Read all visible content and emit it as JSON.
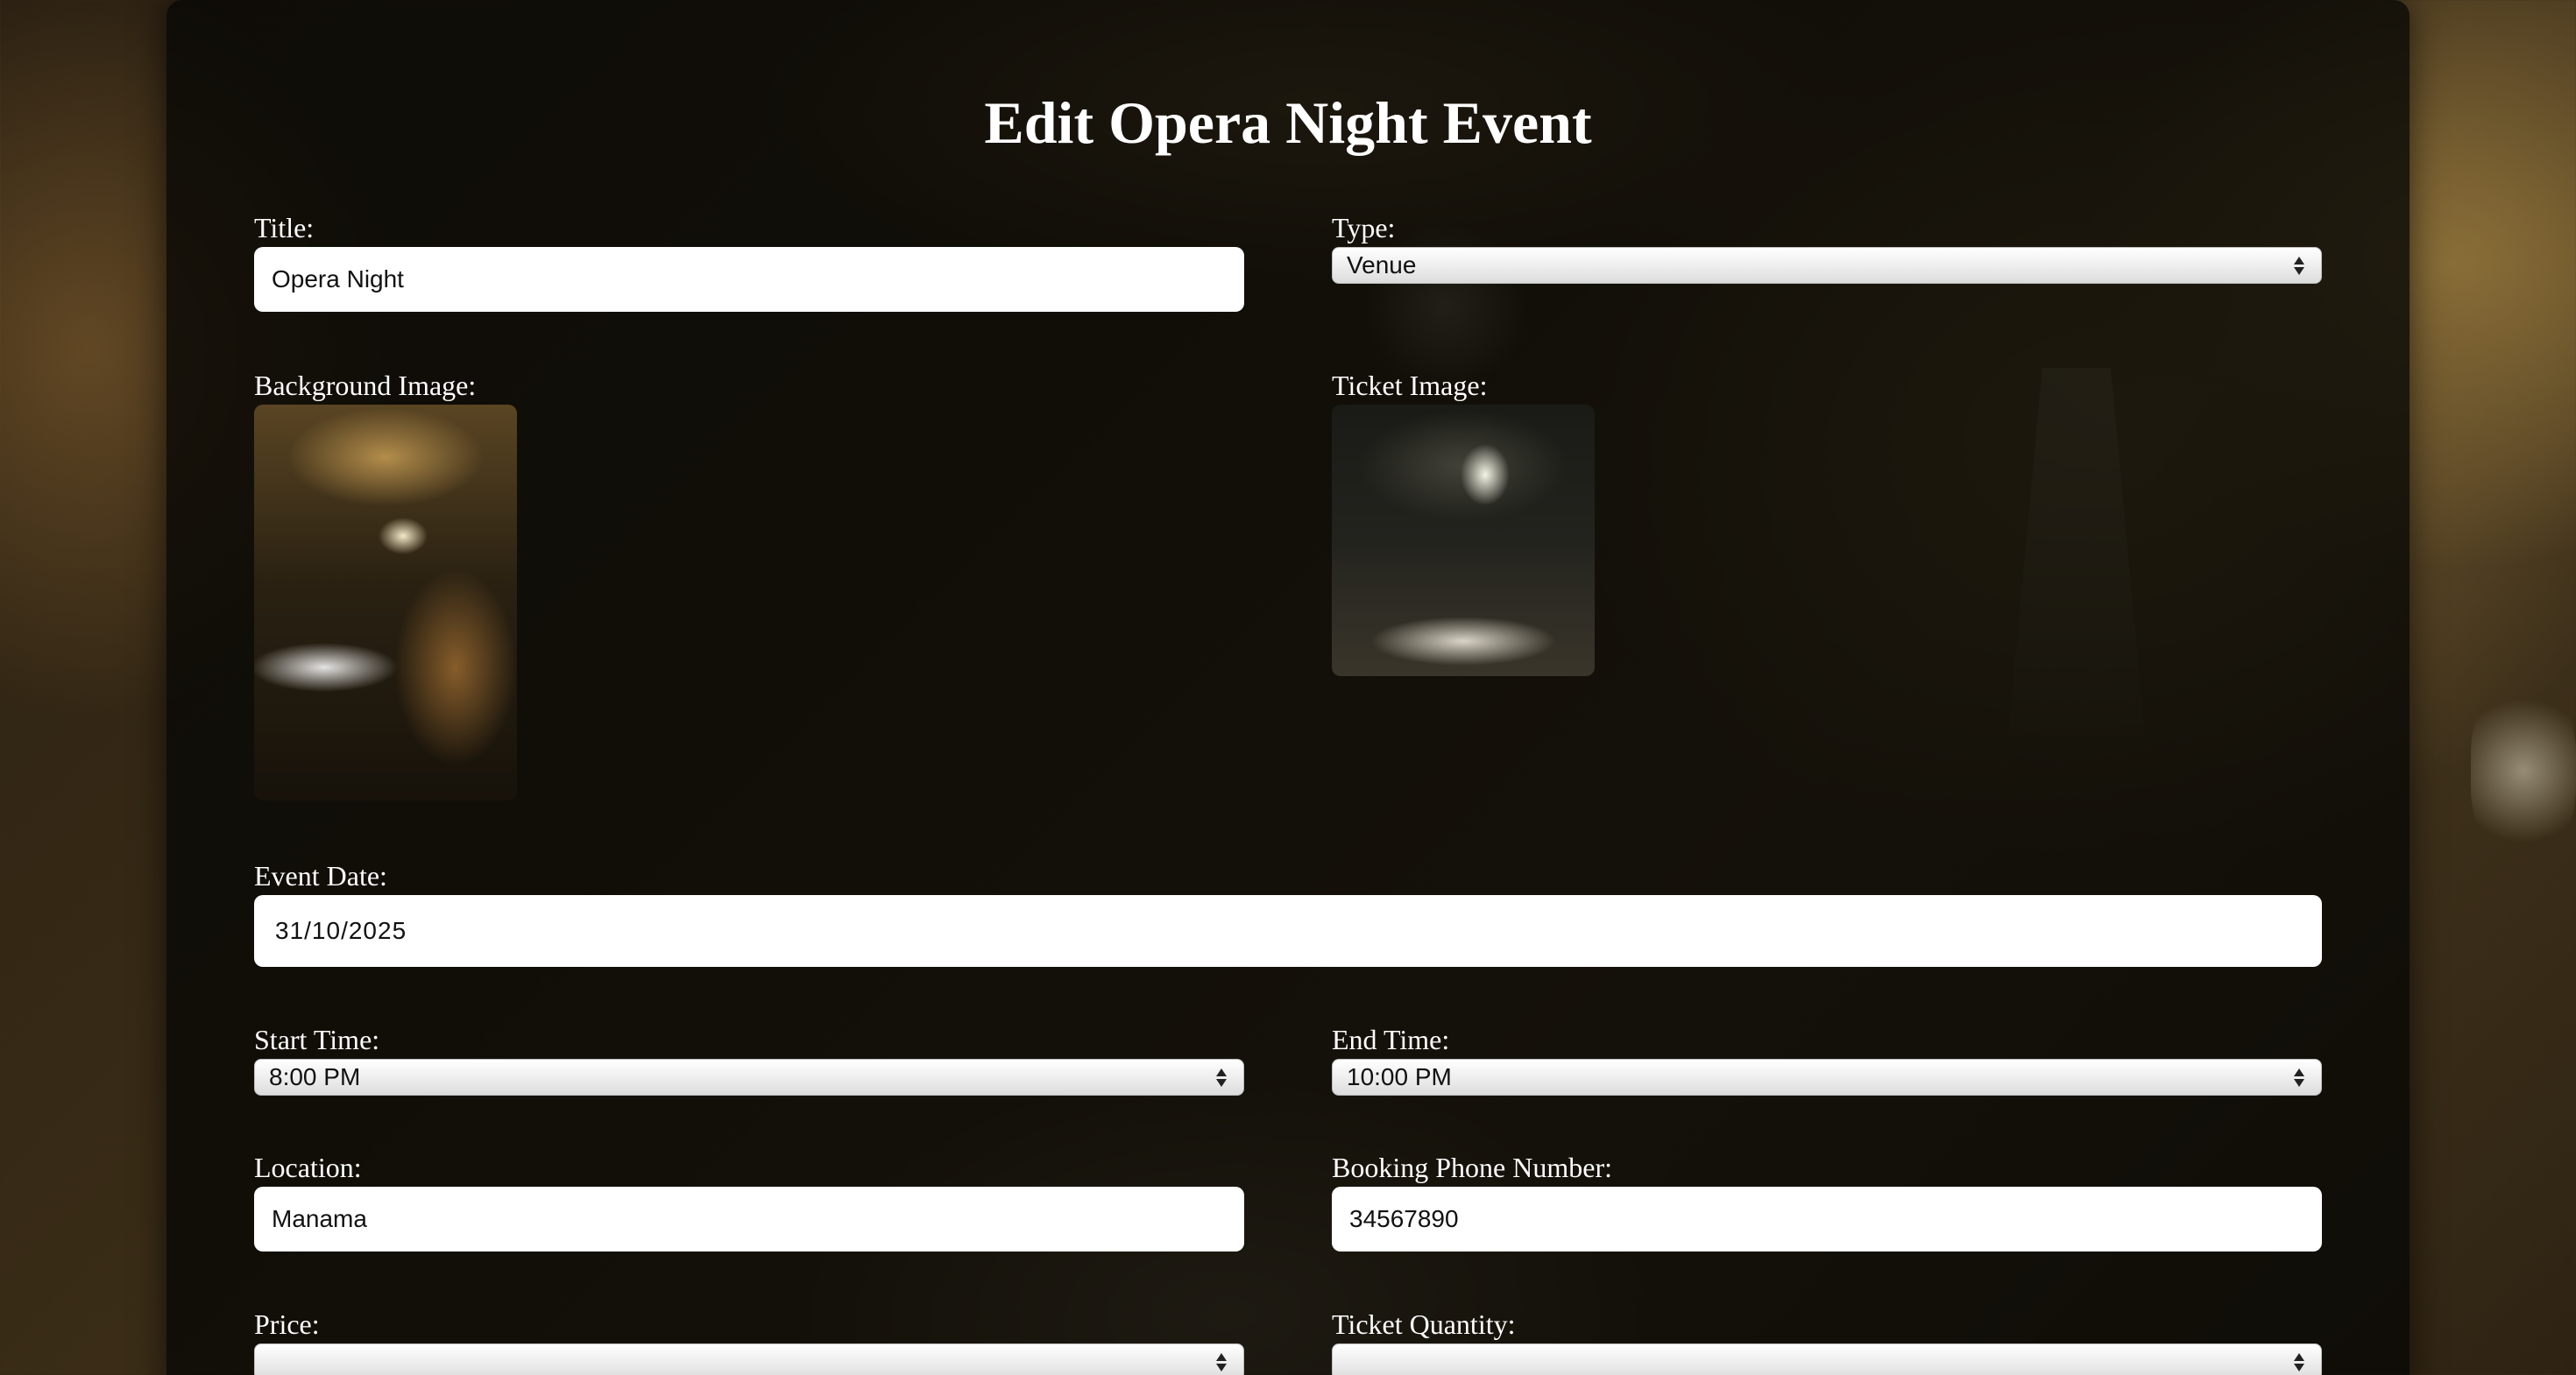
{
  "page": {
    "title": "Edit Opera Night Event"
  },
  "form": {
    "title": {
      "label": "Title:",
      "value": "Opera Night"
    },
    "type": {
      "label": "Type:",
      "value": "Venue"
    },
    "background_image": {
      "label": "Background Image:"
    },
    "ticket_image": {
      "label": "Ticket Image:"
    },
    "event_date": {
      "label": "Event Date:",
      "value": "31/10/2025"
    },
    "start_time": {
      "label": "Start Time:",
      "value": "8:00 PM"
    },
    "end_time": {
      "label": "End Time:",
      "value": "10:00 PM"
    },
    "location": {
      "label": "Location:",
      "value": "Manama"
    },
    "booking_phone": {
      "label": "Booking Phone Number:",
      "value": "34567890"
    },
    "price": {
      "label": "Price:"
    },
    "ticket_quantity": {
      "label": "Ticket Quantity:"
    }
  }
}
